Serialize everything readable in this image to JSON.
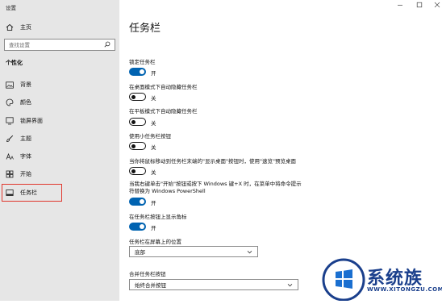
{
  "app": {
    "title": "设置"
  },
  "sidebar": {
    "home_label": "主页",
    "search_placeholder": "查找设置",
    "section_title": "个性化",
    "items": [
      {
        "label": "背景",
        "icon": "image-icon"
      },
      {
        "label": "颜色",
        "icon": "palette-icon"
      },
      {
        "label": "锁屏界面",
        "icon": "lock-screen-icon"
      },
      {
        "label": "主题",
        "icon": "theme-brush-icon"
      },
      {
        "label": "字体",
        "icon": "font-icon"
      },
      {
        "label": "开始",
        "icon": "start-grid-icon"
      },
      {
        "label": "任务栏",
        "icon": "taskbar-icon",
        "active": true
      }
    ]
  },
  "main": {
    "title": "任务栏",
    "settings": [
      {
        "label": "锁定任务栏",
        "state": "开",
        "on": true
      },
      {
        "label": "在桌面模式下自动隐藏任务栏",
        "state": "关",
        "on": false
      },
      {
        "label": "在平板模式下自动隐藏任务栏",
        "state": "关",
        "on": false
      },
      {
        "label": "使用小任务栏按钮",
        "state": "关",
        "on": false
      },
      {
        "label": "当你将鼠标移动到任务栏末端的\"显示桌面\"按钮时，使用\"速览\"预览桌面",
        "state": "关",
        "on": false
      },
      {
        "label": "当我右键单击\"开始\"按钮或按下 Windows 键+X 时，在菜单中将命令提示符替换为 Windows PowerShell",
        "state": "开",
        "on": true
      },
      {
        "label": "在任务栏按钮上显示角标",
        "state": "开",
        "on": true
      }
    ],
    "position": {
      "label": "任务栏在屏幕上的位置",
      "value": "底部"
    },
    "combine": {
      "label": "合并任务栏按钮",
      "value": "始终合并按钮"
    }
  },
  "watermark": {
    "brand": "系统族",
    "url": "WWW.XITONGZU.COM"
  },
  "colors": {
    "accent": "#0063b1",
    "highlight": "#e0362c",
    "sidebar_bg": "#e6e6e6"
  }
}
